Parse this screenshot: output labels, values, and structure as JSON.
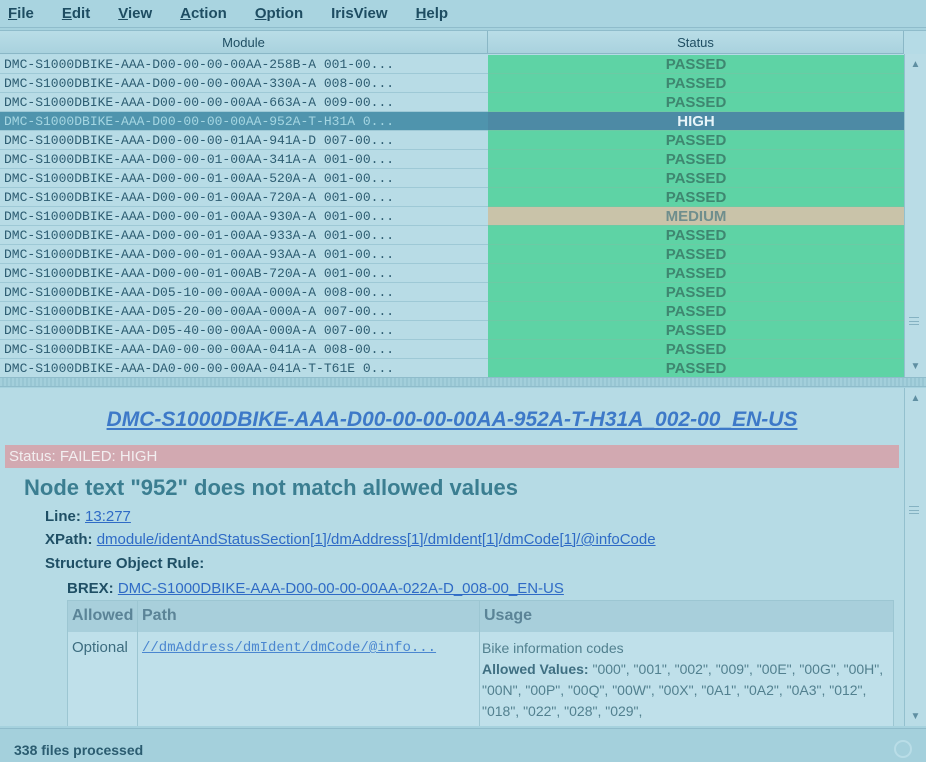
{
  "menu": [
    {
      "mnemonic": "F",
      "rest": "ile"
    },
    {
      "mnemonic": "E",
      "rest": "dit"
    },
    {
      "mnemonic": "V",
      "rest": "iew"
    },
    {
      "mnemonic": "A",
      "rest": "ction"
    },
    {
      "mnemonic": "O",
      "rest": "ption"
    },
    {
      "mnemonic": "",
      "rest": "IrisView"
    },
    {
      "mnemonic": "H",
      "rest": "elp"
    }
  ],
  "table": {
    "headers": {
      "module": "Module",
      "status": "Status"
    },
    "rows": [
      {
        "module": "DMC-S1000DBIKE-AAA-D00-00-00-00AA-258B-A 001-00...",
        "status": "PASSED",
        "state": "passed"
      },
      {
        "module": "DMC-S1000DBIKE-AAA-D00-00-00-00AA-330A-A 008-00...",
        "status": "PASSED",
        "state": "passed"
      },
      {
        "module": "DMC-S1000DBIKE-AAA-D00-00-00-00AA-663A-A 009-00...",
        "status": "PASSED",
        "state": "passed"
      },
      {
        "module": "DMC-S1000DBIKE-AAA-D00-00-00-00AA-952A-T-H31A 0...",
        "status": "HIGH",
        "state": "selected"
      },
      {
        "module": "DMC-S1000DBIKE-AAA-D00-00-00-01AA-941A-D 007-00...",
        "status": "PASSED",
        "state": "passed"
      },
      {
        "module": "DMC-S1000DBIKE-AAA-D00-00-01-00AA-341A-A 001-00...",
        "status": "PASSED",
        "state": "passed"
      },
      {
        "module": "DMC-S1000DBIKE-AAA-D00-00-01-00AA-520A-A 001-00...",
        "status": "PASSED",
        "state": "passed"
      },
      {
        "module": "DMC-S1000DBIKE-AAA-D00-00-01-00AA-720A-A 001-00...",
        "status": "PASSED",
        "state": "passed"
      },
      {
        "module": "DMC-S1000DBIKE-AAA-D00-00-01-00AA-930A-A 001-00...",
        "status": "MEDIUM",
        "state": "medium"
      },
      {
        "module": "DMC-S1000DBIKE-AAA-D00-00-01-00AA-933A-A 001-00...",
        "status": "PASSED",
        "state": "passed"
      },
      {
        "module": "DMC-S1000DBIKE-AAA-D00-00-01-00AA-93AA-A 001-00...",
        "status": "PASSED",
        "state": "passed"
      },
      {
        "module": "DMC-S1000DBIKE-AAA-D00-00-01-00AB-720A-A 001-00...",
        "status": "PASSED",
        "state": "passed"
      },
      {
        "module": "DMC-S1000DBIKE-AAA-D05-10-00-00AA-000A-A 008-00...",
        "status": "PASSED",
        "state": "passed"
      },
      {
        "module": "DMC-S1000DBIKE-AAA-D05-20-00-00AA-000A-A 007-00...",
        "status": "PASSED",
        "state": "passed"
      },
      {
        "module": "DMC-S1000DBIKE-AAA-D05-40-00-00AA-000A-A 007-00...",
        "status": "PASSED",
        "state": "passed"
      },
      {
        "module": "DMC-S1000DBIKE-AAA-DA0-00-00-00AA-041A-A 008-00...",
        "status": "PASSED",
        "state": "passed"
      },
      {
        "module": "DMC-S1000DBIKE-AAA-DA0-00-00-00AA-041A-T-T61E 0...",
        "status": "PASSED",
        "state": "passed"
      }
    ]
  },
  "detail": {
    "title": "DMC-S1000DBIKE-AAA-D00-00-00-00AA-952A-T-H31A_002-00_EN-US",
    "status": "Status: FAILED: HIGH",
    "error": "Node text \"952\" does not match allowed values",
    "line_label": "Line:",
    "line_value": "13:277",
    "xpath_label": "XPath:",
    "xpath_value": "dmodule/identAndStatusSection[1]/dmAddress[1]/dmIdent[1]/dmCode[1]/@infoCode",
    "rule_label": "Structure Object Rule:",
    "brex_label": "BREX:",
    "brex_value": "DMC-S1000DBIKE-AAA-D00-00-00-00AA-022A-D_008-00_EN-US",
    "rule_table": {
      "headers": {
        "allowed": "Allowed",
        "path": "Path",
        "usage": "Usage"
      },
      "row": {
        "allowed": "Optional",
        "path": "//dmAddress/dmIdent/dmCode/@info...",
        "usage": "Bike information codes",
        "allowed_values_label": "Allowed Values:",
        "allowed_values": "\"000\", \"001\", \"002\", \"009\", \"00E\", \"00G\", \"00H\", \"00N\", \"00P\", \"00Q\", \"00W\", \"00X\", \"0A1\", \"0A2\", \"0A3\", \"012\", \"018\", \"022\", \"028\", \"029\","
      }
    }
  },
  "footer": {
    "status": "338 files processed"
  },
  "icons": {
    "scroll_up": "triangle-up",
    "scroll_down": "triangle-down",
    "busy": "spinner"
  }
}
